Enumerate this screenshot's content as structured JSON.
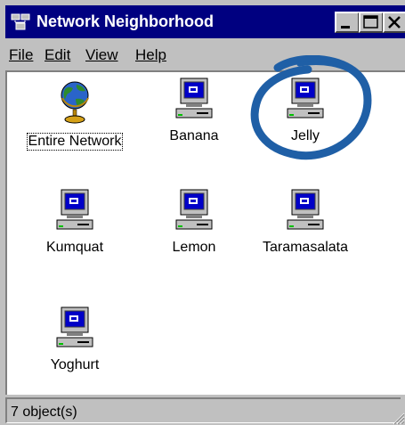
{
  "window": {
    "title": "Network Neighborhood",
    "title_icon": "network-neighborhood-icon"
  },
  "menu": [
    "File",
    "Edit",
    "View",
    "Help"
  ],
  "items": [
    {
      "label": "Entire Network",
      "icon": "globe-icon",
      "focused": true
    },
    {
      "label": "Banana",
      "icon": "computer-icon"
    },
    {
      "label": "Jelly",
      "icon": "computer-icon",
      "annotated": true
    },
    {
      "label": "Kumquat",
      "icon": "computer-icon"
    },
    {
      "label": "Lemon",
      "icon": "computer-icon"
    },
    {
      "label": "Taramasalata",
      "icon": "computer-icon"
    },
    {
      "label": "Yoghurt",
      "icon": "computer-icon"
    }
  ],
  "status": {
    "text": "7 object(s)"
  },
  "colors": {
    "title_bar": "#000080",
    "annotation": "#1f5fa6",
    "window_face": "#c0c0c0"
  }
}
